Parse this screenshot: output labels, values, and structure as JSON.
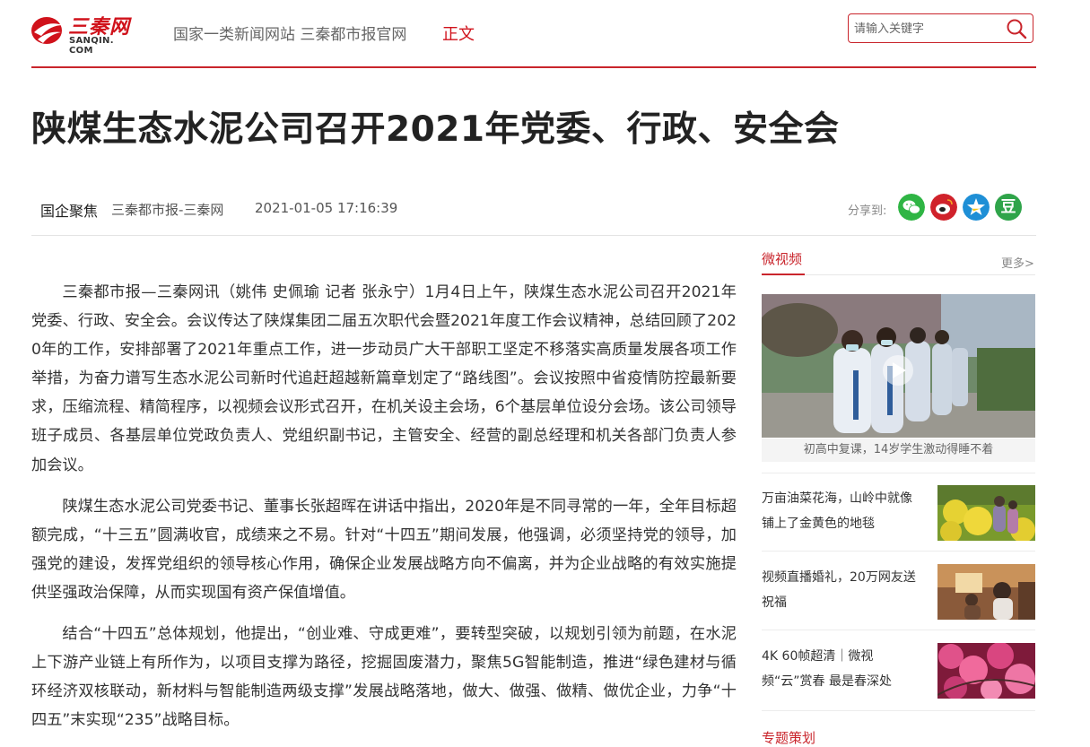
{
  "header": {
    "logo_cn": "三秦网",
    "logo_en": "SANQIN. COM",
    "slogan": "国家一类新闻网站 三秦都市报官网",
    "breadcrumb_current": "正文",
    "search": {
      "placeholder": "请输入关键字",
      "value": ""
    }
  },
  "colors": {
    "brand_red": "#c9252c",
    "wechat": "#2fb544",
    "weibo": "#d0222b",
    "qzone": "#1e8fd6",
    "douban": "#2fa44a"
  },
  "article": {
    "title": "陕煤生态水泥公司召开2021年党委、行政、安全会",
    "category": "国企聚焦",
    "source": "三秦都市报-三秦网",
    "time": "2021-01-05 17:16:39",
    "share_label": "分享到:",
    "share_icons": [
      "wechat-icon",
      "weibo-icon",
      "qzone-icon",
      "douban-icon"
    ],
    "douban_glyph": "豆",
    "paragraphs": [
      "三秦都市报—三秦网讯（姚伟 史佩瑜 记者 张永宁）1月4日上午，陕煤生态水泥公司召开2021年党委、行政、安全会。会议传达了陕煤集团二届五次职代会暨2021年度工作会议精神，总结回顾了2020年的工作，安排部署了2021年重点工作，进一步动员广大干部职工坚定不移落实高质量发展各项工作举措，为奋力谱写生态水泥公司新时代追赶超越新篇章划定了“路线图”。会议按照中省疫情防控最新要求，压缩流程、精简程序，以视频会议形式召开，在机关设主会场，6个基层单位设分会场。该公司领导班子成员、各基层单位党政负责人、党组织副书记，主管安全、经营的副总经理和机关各部门负责人参加会议。",
      "陕煤生态水泥公司党委书记、董事长张超晖在讲话中指出，2020年是不同寻常的一年，全年目标超额完成，“十三五”圆满收官，成绩来之不易。针对“十四五”期间发展，他强调，必须坚持党的领导，加强党的建设，发挥党组织的领导核心作用，确保企业发展战略方向不偏离，并为企业战略的有效实施提供坚强政治保障，从而实现国有资产保值增值。",
      "结合“十四五”总体规划，他提出，“创业难、守成更难”，要转型突破，以规划引领为前题，在水泥上下游产业链上有所作为，以项目支撑为路径，挖掘固废潜力，聚焦5G智能制造，推进“绿色建材与循环经济双核联动，新材料与智能制造两级支撑”发展战略落地，做大、做强、做精、做优企业，力争“十四五”末实现“235”战略目标。"
    ]
  },
  "sidebar": {
    "heading": "微视频",
    "more": "更多>",
    "featured_caption": "初高中复课，14岁学生激动得睡不着",
    "items": [
      {
        "title": "万亩油菜花海，山岭中就像铺上了金黄色的地毯"
      },
      {
        "title": "视频直播婚礼，20万网友送祝福"
      },
      {
        "title": "4K 60帧超清｜微视频“云”赏春 最是春深处"
      }
    ],
    "next_heading": "专题策划"
  }
}
